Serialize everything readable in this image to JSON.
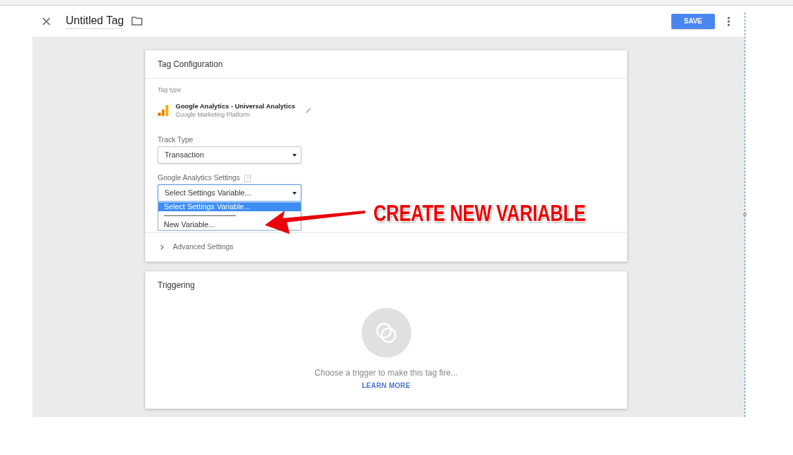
{
  "header": {
    "title": "Untitled Tag",
    "save_button": "SAVE"
  },
  "tag_configuration": {
    "title": "Tag Configuration",
    "tag_type_label": "Tag type",
    "tag_type": {
      "name": "Google Analytics - Universal Analytics",
      "provider": "Google Marketing Platform"
    },
    "fields": [
      {
        "label": "Track Type",
        "value": "Transaction",
        "focused": false
      },
      {
        "label": "Google Analytics Settings",
        "help": "?",
        "value": "Select Settings Variable...",
        "focused": true,
        "expanded": true,
        "options": [
          {
            "kind": "option",
            "label": "Select Settings Variable...",
            "selected": true
          },
          {
            "kind": "separator"
          },
          {
            "kind": "option",
            "label": "New Variable...",
            "selected": false
          }
        ]
      }
    ],
    "advanced": {
      "label": "Advanced Settings",
      "expanded": false
    }
  },
  "triggering": {
    "title": "Triggering",
    "message": "Choose a trigger to make this tag fire...",
    "link": "LEARN MORE"
  },
  "annotation": {
    "text": "CREATE NEW VARIABLE"
  }
}
